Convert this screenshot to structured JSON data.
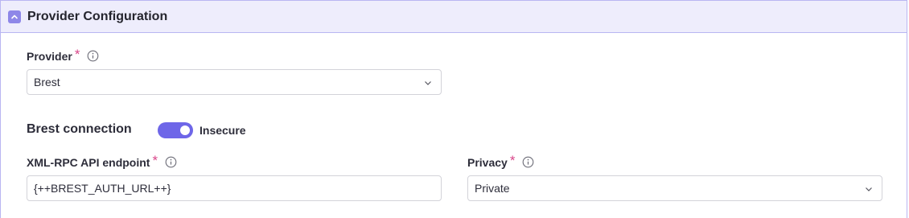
{
  "panel": {
    "title": "Provider Configuration"
  },
  "provider": {
    "label": "Provider",
    "required_mark": "*",
    "value": "Brest"
  },
  "connection": {
    "title": "Brest connection",
    "toggle_label": "Insecure",
    "toggle_on": true
  },
  "endpoint": {
    "label": "XML-RPC API endpoint",
    "required_mark": "*",
    "value": "{++BREST_AUTH_URL++}"
  },
  "privacy": {
    "label": "Privacy",
    "required_mark": "*",
    "value": "Private"
  },
  "colors": {
    "accent": "#6e66e8",
    "required": "#d9468a",
    "header_bg": "#eeedfc",
    "border": "#b9b6f2"
  }
}
